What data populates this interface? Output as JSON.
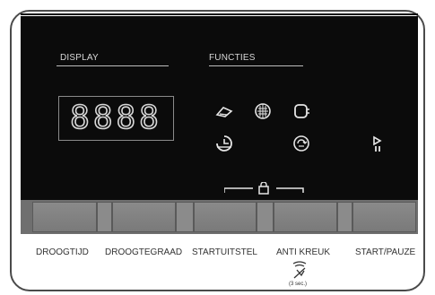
{
  "sections": {
    "display_title": "DISPLAY",
    "functions_title": "FUNCTIES"
  },
  "display": {
    "digits": "8888"
  },
  "buttons": [
    {
      "id": "droogtijd",
      "label": "DROOGTIJD"
    },
    {
      "id": "droogtegraad",
      "label": "DROOGTEGRAAD"
    },
    {
      "id": "startuitstel",
      "label": "STARTUITSTEL"
    },
    {
      "id": "anti-kreuk",
      "label": "ANTI KREUK"
    },
    {
      "id": "start-pauze",
      "label": "START/PAUZE"
    }
  ],
  "anti_kreuk_hold": "(3 sec.)",
  "icons": {
    "function_row1": [
      "iron-icon",
      "drum-icon",
      "wash-icon"
    ],
    "function_row2": [
      "timer-icon",
      "cycle-icon"
    ],
    "start_pause": "play-pause-icon",
    "lock": "child-lock-icon",
    "no_crease": "crossed-clothes-icon"
  },
  "colors": {
    "panel": "#0b0b0b",
    "glyph": "#d8d8d8",
    "button": "#808080"
  }
}
